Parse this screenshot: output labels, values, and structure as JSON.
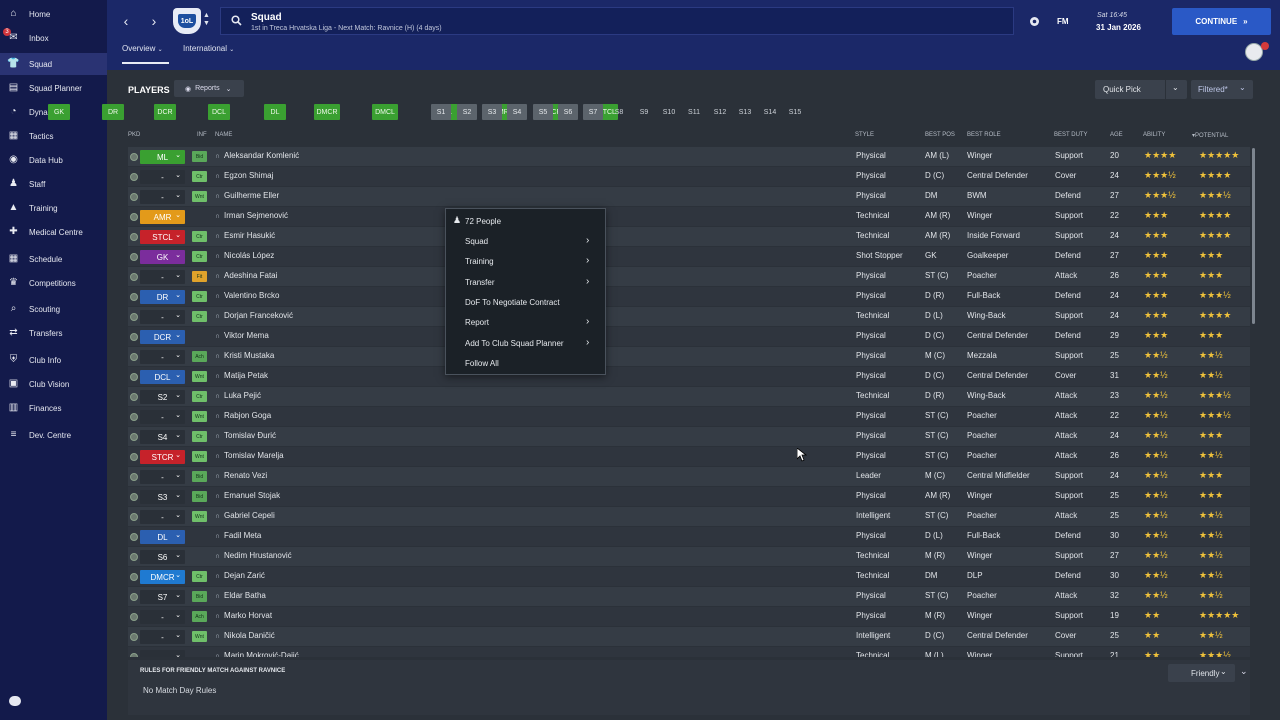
{
  "sidebar": {
    "items": [
      {
        "label": "Home",
        "icon": "home-icon"
      },
      {
        "label": "Inbox",
        "icon": "inbox-icon",
        "badge": "3"
      },
      {
        "label": "Squad",
        "icon": "squad-icon",
        "active": true
      },
      {
        "label": "Squad Planner",
        "icon": "squad-planner-icon"
      },
      {
        "label": "Dynamics",
        "icon": "dynamics-icon"
      },
      {
        "label": "Tactics",
        "icon": "tactics-icon"
      },
      {
        "label": "Data Hub",
        "icon": "data-hub-icon"
      },
      {
        "label": "Staff",
        "icon": "staff-icon"
      },
      {
        "label": "Training",
        "icon": "training-icon"
      },
      {
        "label": "Medical Centre",
        "icon": "medical-icon"
      },
      {
        "label": "Schedule",
        "icon": "schedule-icon"
      },
      {
        "label": "Competitions",
        "icon": "trophy-icon"
      },
      {
        "label": "Scouting",
        "icon": "scouting-icon"
      },
      {
        "label": "Transfers",
        "icon": "transfers-icon"
      },
      {
        "label": "Club Info",
        "icon": "club-info-icon"
      },
      {
        "label": "Club Vision",
        "icon": "club-vision-icon"
      },
      {
        "label": "Finances",
        "icon": "finances-icon"
      },
      {
        "label": "Dev. Centre",
        "icon": "dev-centre-icon"
      }
    ]
  },
  "header": {
    "title": "Squad",
    "subtitle": "1st in Treca Hrvatska Liga - Next Match: Ravnice (H) (4 days)",
    "crest_text": "1oL",
    "fm_label": "FM",
    "date_line1": "Sat 16:45",
    "date_line2": "31 Jan 2026",
    "continue_label": "CONTINUE",
    "subtabs": [
      "Overview",
      "International"
    ]
  },
  "toolbar": {
    "players_label": "PLAYERS",
    "reports_label": "Reports",
    "quick_pick_label": "Quick Pick",
    "filtered_label": "Filtered*"
  },
  "position_chips": {
    "green": [
      "GK",
      "DR",
      "DCR",
      "DCL",
      "DL",
      "DMCR",
      "DMCL",
      "ML",
      "AMR",
      "STCR",
      "STCL"
    ],
    "subs_filled": [
      "S1",
      "S2",
      "S3",
      "S4",
      "S5",
      "S6",
      "S7"
    ],
    "subs_empty": [
      "S8",
      "S9",
      "S10",
      "S11",
      "S12",
      "S13",
      "S14",
      "S15"
    ]
  },
  "columns": {
    "pkd": "PKD",
    "inf": "INF",
    "name": "NAME",
    "style": "STYLE",
    "best_pos": "BEST POS",
    "best_role": "BEST ROLE",
    "best_duty": "BEST DUTY",
    "age": "AGE",
    "ability": "ABILITY",
    "potential": "POTENTIAL"
  },
  "players": [
    {
      "pos": "ML",
      "pc": "#3aa031",
      "inf": "Bid",
      "ic": "#5aa85a",
      "name": "Aleksandar Komlenić",
      "style": "Physical",
      "best_pos": "AM (L)",
      "role": "Winger",
      "duty": "Support",
      "age": "20",
      "ability": "★★★★",
      "potential": "★★★★★"
    },
    {
      "pos": "-",
      "pc": "",
      "inf": "Ctr",
      "ic": "#6fbf6a",
      "name": "Egzon Shimaj",
      "style": "Physical",
      "best_pos": "D (C)",
      "role": "Central Defender",
      "duty": "Cover",
      "age": "24",
      "ability": "★★★½",
      "potential": "★★★★"
    },
    {
      "pos": "-",
      "pc": "",
      "inf": "Wnt",
      "ic": "#6fbf6a",
      "name": "Guilherme Eller",
      "style": "Physical",
      "best_pos": "DM",
      "role": "BWM",
      "duty": "Defend",
      "age": "27",
      "ability": "★★★½",
      "potential": "★★★½"
    },
    {
      "pos": "AMR",
      "pc": "#e39a1a",
      "inf": "",
      "ic": "",
      "name": "Irman Sejmenović",
      "style": "Technical",
      "best_pos": "AM (R)",
      "role": "Winger",
      "duty": "Support",
      "age": "22",
      "ability": "★★★",
      "potential": "★★★★"
    },
    {
      "pos": "STCL",
      "pc": "#c6222a",
      "inf": "Ctr",
      "ic": "#6fbf6a",
      "name": "Esmir Hasukić",
      "style": "Technical",
      "best_pos": "AM (R)",
      "role": "Inside Forward",
      "duty": "Support",
      "age": "24",
      "ability": "★★★",
      "potential": "★★★★"
    },
    {
      "pos": "GK",
      "pc": "#7b2d9c",
      "inf": "Ctr",
      "ic": "#6fbf6a",
      "name": "Nicolás López",
      "style": "Shot Stopper",
      "best_pos": "GK",
      "role": "Goalkeeper",
      "duty": "Defend",
      "age": "27",
      "ability": "★★★",
      "potential": "★★★"
    },
    {
      "pos": "-",
      "pc": "",
      "inf": "Fit",
      "ic": "#e0a22b",
      "name": "Adeshina Fatai",
      "style": "Physical",
      "best_pos": "ST (C)",
      "role": "Poacher",
      "duty": "Attack",
      "age": "26",
      "ability": "★★★",
      "potential": "★★★"
    },
    {
      "pos": "DR",
      "pc": "#2b5fb0",
      "inf": "Ctr",
      "ic": "#6fbf6a",
      "name": "Valentino Brcko",
      "style": "Physical",
      "best_pos": "D (R)",
      "role": "Full-Back",
      "duty": "Defend",
      "age": "24",
      "ability": "★★★",
      "potential": "★★★½"
    },
    {
      "pos": "-",
      "pc": "",
      "inf": "Ctr",
      "ic": "#6fbf6a",
      "name": "Dorjan Franceković",
      "style": "Technical",
      "best_pos": "D (L)",
      "role": "Wing-Back",
      "duty": "Support",
      "age": "24",
      "ability": "★★★",
      "potential": "★★★★"
    },
    {
      "pos": "DCR",
      "pc": "#2b5fb0",
      "inf": "",
      "ic": "",
      "name": "Viktor Mema",
      "style": "Physical",
      "best_pos": "D (C)",
      "role": "Central Defender",
      "duty": "Defend",
      "age": "29",
      "ability": "★★★",
      "potential": "★★★"
    },
    {
      "pos": "-",
      "pc": "",
      "inf": "Ach",
      "ic": "#5aa85a",
      "name": "Kristi Mustaka",
      "style": "Physical",
      "best_pos": "M (C)",
      "role": "Mezzala",
      "duty": "Support",
      "age": "25",
      "ability": "★★½",
      "potential": "★★½"
    },
    {
      "pos": "DCL",
      "pc": "#2b5fb0",
      "inf": "Wnt",
      "ic": "#6fbf6a",
      "name": "Matija Petak",
      "style": "Physical",
      "best_pos": "D (C)",
      "role": "Central Defender",
      "duty": "Cover",
      "age": "31",
      "ability": "★★½",
      "potential": "★★½"
    },
    {
      "pos": "S2",
      "pc": "",
      "inf": "Ctr",
      "ic": "#6fbf6a",
      "name": "Luka Pejić",
      "style": "Technical",
      "best_pos": "D (R)",
      "role": "Wing-Back",
      "duty": "Attack",
      "age": "23",
      "ability": "★★½",
      "potential": "★★★½"
    },
    {
      "pos": "-",
      "pc": "",
      "inf": "Wnt",
      "ic": "#6fbf6a",
      "name": "Rabjon Goga",
      "style": "Physical",
      "best_pos": "ST (C)",
      "role": "Poacher",
      "duty": "Attack",
      "age": "22",
      "ability": "★★½",
      "potential": "★★★½"
    },
    {
      "pos": "S4",
      "pc": "",
      "inf": "Ctr",
      "ic": "#6fbf6a",
      "name": "Tomislav Đurić",
      "style": "Physical",
      "best_pos": "ST (C)",
      "role": "Poacher",
      "duty": "Attack",
      "age": "24",
      "ability": "★★½",
      "potential": "★★★"
    },
    {
      "pos": "STCR",
      "pc": "#c6222a",
      "inf": "Wnt",
      "ic": "#6fbf6a",
      "name": "Tomislav Marelja",
      "style": "Physical",
      "best_pos": "ST (C)",
      "role": "Poacher",
      "duty": "Attack",
      "age": "26",
      "ability": "★★½",
      "potential": "★★½"
    },
    {
      "pos": "-",
      "pc": "",
      "inf": "Bid",
      "ic": "#5aa85a",
      "name": "Renato Vezi",
      "style": "Leader",
      "best_pos": "M (C)",
      "role": "Central Midfielder",
      "duty": "Support",
      "age": "24",
      "ability": "★★½",
      "potential": "★★★"
    },
    {
      "pos": "S3",
      "pc": "",
      "inf": "Bid",
      "ic": "#5aa85a",
      "name": "Emanuel Stojak",
      "style": "Physical",
      "best_pos": "AM (R)",
      "role": "Winger",
      "duty": "Support",
      "age": "25",
      "ability": "★★½",
      "potential": "★★★"
    },
    {
      "pos": "-",
      "pc": "",
      "inf": "Wnt",
      "ic": "#6fbf6a",
      "name": "Gabriel Cepeli",
      "style": "Intelligent",
      "best_pos": "ST (C)",
      "role": "Poacher",
      "duty": "Attack",
      "age": "25",
      "ability": "★★½",
      "potential": "★★½"
    },
    {
      "pos": "DL",
      "pc": "#2b5fb0",
      "inf": "",
      "ic": "",
      "name": "Fadil Meta",
      "style": "Physical",
      "best_pos": "D (L)",
      "role": "Full-Back",
      "duty": "Defend",
      "age": "30",
      "ability": "★★½",
      "potential": "★★½"
    },
    {
      "pos": "S6",
      "pc": "",
      "inf": "",
      "ic": "",
      "name": "Nedim Hrustanović",
      "style": "Technical",
      "best_pos": "M (R)",
      "role": "Winger",
      "duty": "Support",
      "age": "27",
      "ability": "★★½",
      "potential": "★★½"
    },
    {
      "pos": "DMCR",
      "pc": "#1f7ad1",
      "inf": "Ctr",
      "ic": "#6fbf6a",
      "name": "Dejan Zarić",
      "style": "Technical",
      "best_pos": "DM",
      "role": "DLP",
      "duty": "Defend",
      "age": "30",
      "ability": "★★½",
      "potential": "★★½"
    },
    {
      "pos": "S7",
      "pc": "",
      "inf": "Bid",
      "ic": "#5aa85a",
      "name": "Eldar Batha",
      "style": "Physical",
      "best_pos": "ST (C)",
      "role": "Poacher",
      "duty": "Attack",
      "age": "32",
      "ability": "★★½",
      "potential": "★★½"
    },
    {
      "pos": "-",
      "pc": "",
      "inf": "Ach",
      "ic": "#5aa85a",
      "name": "Marko Horvat",
      "style": "Physical",
      "best_pos": "M (R)",
      "role": "Winger",
      "duty": "Support",
      "age": "19",
      "ability": "★★",
      "potential": "★★★★★"
    },
    {
      "pos": "-",
      "pc": "",
      "inf": "Wnt",
      "ic": "#6fbf6a",
      "name": "Nikola Daničić",
      "style": "Intelligent",
      "best_pos": "D (C)",
      "role": "Central Defender",
      "duty": "Cover",
      "age": "25",
      "ability": "★★",
      "potential": "★★½"
    },
    {
      "pos": "-",
      "pc": "",
      "inf": "",
      "ic": "",
      "name": "Marin Mokrović-Dajić",
      "style": "Technical",
      "best_pos": "M (L)",
      "role": "Winger",
      "duty": "Support",
      "age": "21",
      "ability": "★★",
      "potential": "★★★½"
    }
  ],
  "context_menu": {
    "header": "72 People",
    "items": [
      {
        "label": "Squad",
        "sub": true
      },
      {
        "label": "Training",
        "sub": true
      },
      {
        "label": "Transfer",
        "sub": true
      },
      {
        "label": "DoF To Negotiate Contract",
        "sub": false
      },
      {
        "label": "Report",
        "sub": true
      },
      {
        "label": "Add To Club Squad Planner",
        "sub": true
      },
      {
        "label": "Follow All",
        "sub": false
      }
    ]
  },
  "bottom": {
    "rules_title": "RULES FOR FRIENDLY MATCH AGAINST RAVNICE",
    "rules_text": "No Match Day Rules",
    "friendly_label": "Friendly"
  }
}
